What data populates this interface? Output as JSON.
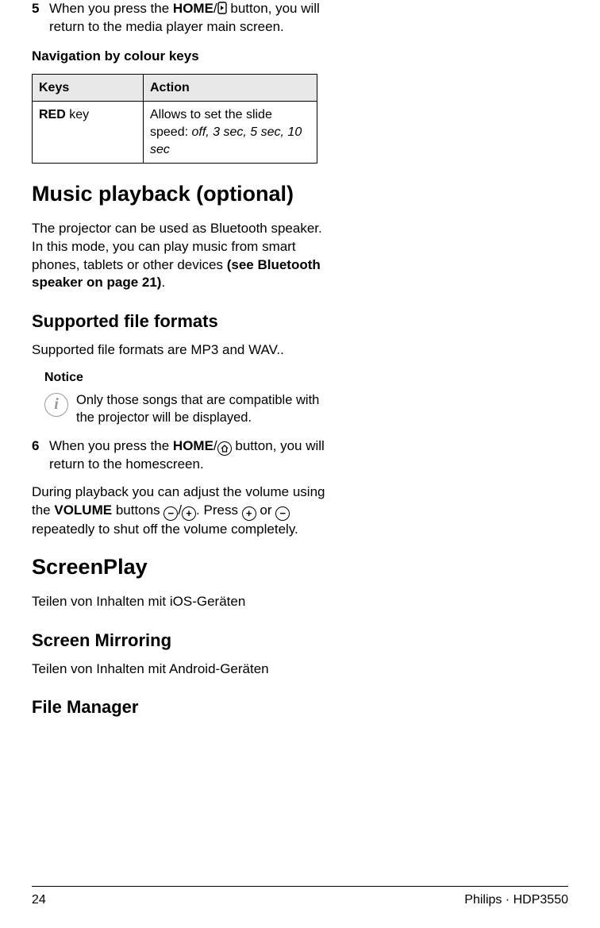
{
  "step5": {
    "num": "5",
    "text_before": "When you press the ",
    "home": "HOME",
    "slash": "/",
    "text_after": " button, you will return to the media player main screen."
  },
  "nav_heading": "Navigation by colour keys",
  "table": {
    "th1": "Keys",
    "th2": "Action",
    "cell1_bold": "RED",
    "cell1_rest": " key",
    "cell2_before": "Allows to set the slide speed: ",
    "cell2_italic": "off, 3 sec, 5 sec, 10 sec"
  },
  "music_h1": "Music playback (optional)",
  "music_para_before": "The projector can be used as Bluetooth speaker. In this mode, you can play music from smart phones, tablets or other devices ",
  "music_para_bold": "(see Bluetooth speaker on page 21)",
  "music_para_after": ".",
  "supported_h2": "Supported file formats",
  "supported_para": "Supported file formats are MP3 and WAV..",
  "notice": {
    "label": "Notice",
    "text": "Only those songs that are compatible with the projector will be displayed."
  },
  "step6": {
    "num": "6",
    "text_before": "When you press the ",
    "home": "HOME",
    "slash": "/",
    "text_after": " button, you will return to the homescreen."
  },
  "playback_para": {
    "p1": "During playback you can adjust the volume using the ",
    "volume": "VOLUME",
    "p2": " buttons ",
    "slash": "/",
    "p3": ". Press ",
    "p4": " or ",
    "p5": " repeatedly to shut off the volume completely."
  },
  "screenplay_h1": "ScreenPlay",
  "screenplay_para": "Teilen von Inhalten mit iOS-Geräten",
  "mirroring_h2": "Screen Mirroring",
  "mirroring_para": "Teilen von Inhalten mit Android-Geräten",
  "filemgr_h2": "File Manager",
  "footer": {
    "page": "24",
    "product": "Philips · HDP3550"
  }
}
